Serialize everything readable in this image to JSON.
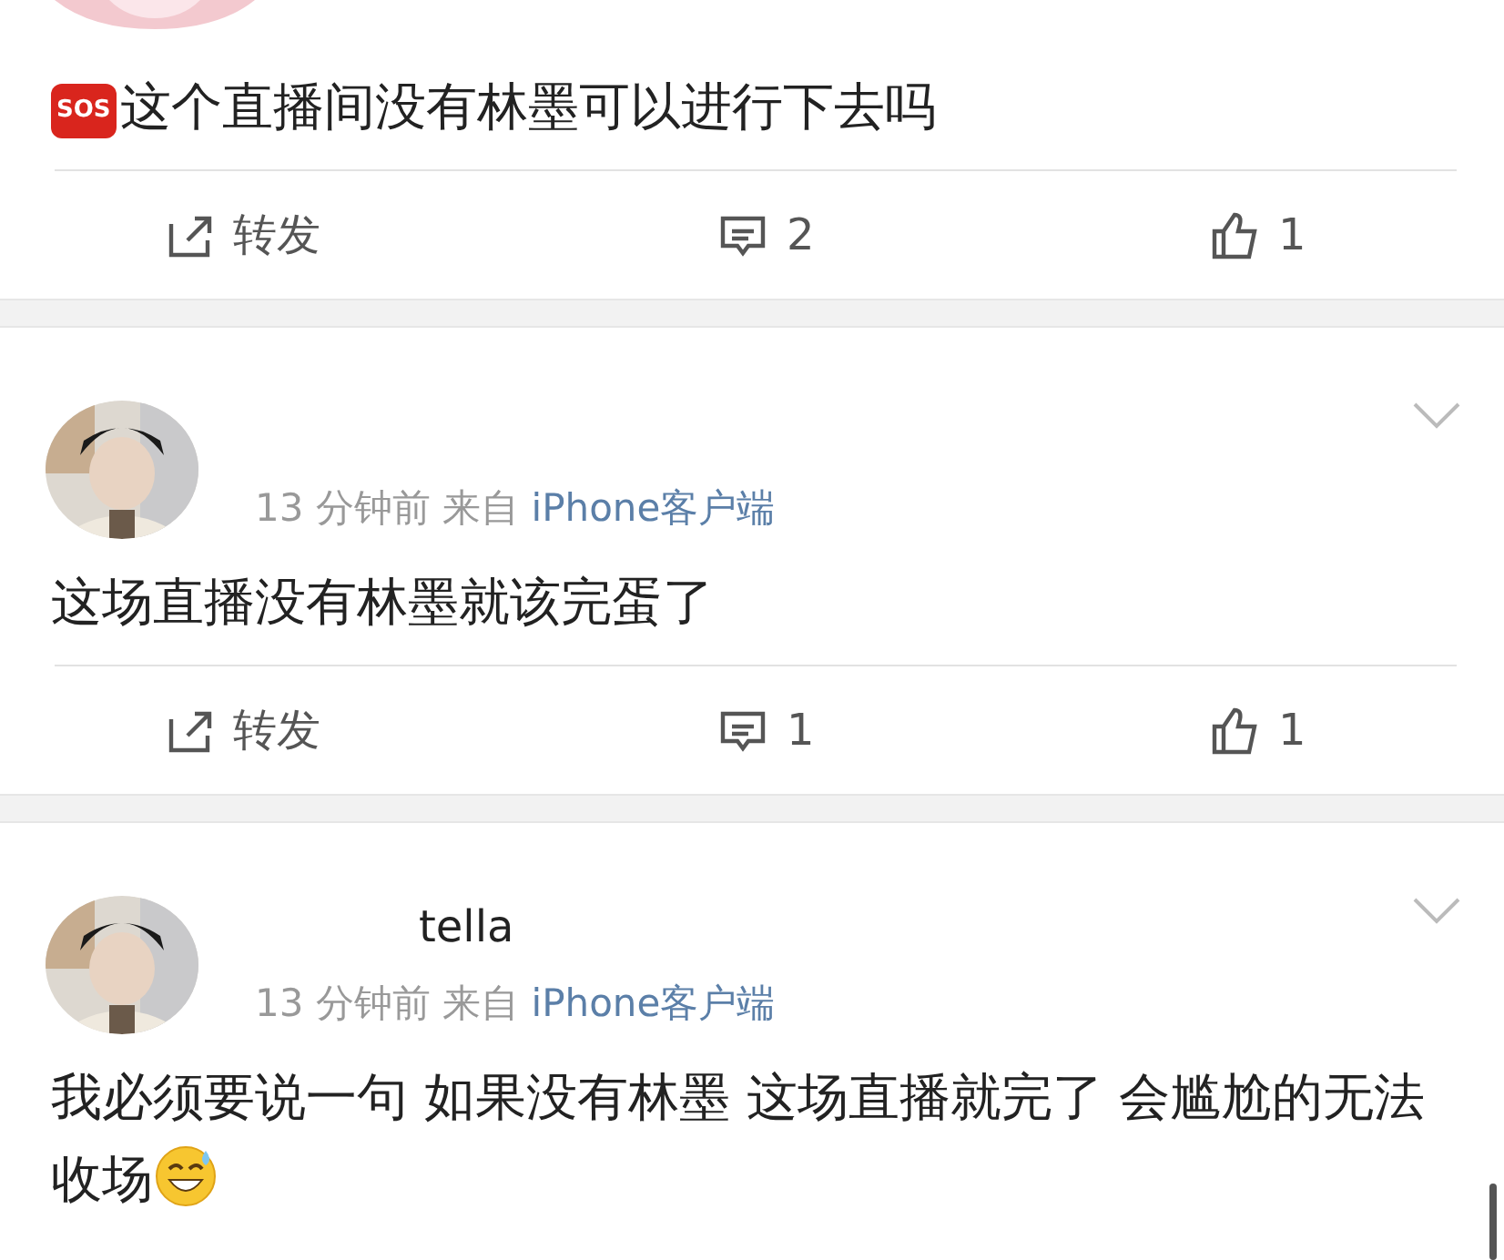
{
  "posts": [
    {
      "content": [
        {
          "kind": "badge",
          "text": "SOS"
        },
        {
          "kind": "text",
          "text": "这个直播间没有林墨可以进行下去吗"
        }
      ],
      "actions": {
        "repost": "转发",
        "comments": "2",
        "likes": "1"
      }
    },
    {
      "time": "13 分钟前",
      "from": "来自",
      "source": "iPhone客户端",
      "content": [
        {
          "kind": "text",
          "text": "这场直播没有林墨就该完蛋了"
        }
      ],
      "actions": {
        "repost": "转发",
        "comments": "1",
        "likes": "1"
      }
    },
    {
      "name": "tella",
      "time": "13 分钟前",
      "from": "来自",
      "source": "iPhone客户端",
      "content": [
        {
          "kind": "text",
          "text": "我必须要说一句 如果没有林墨 这场直播就完了 会尴尬的无法收场"
        },
        {
          "kind": "emoji"
        }
      ]
    }
  ]
}
